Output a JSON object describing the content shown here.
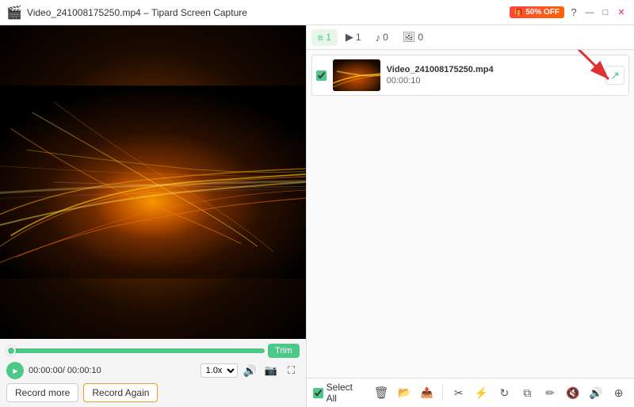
{
  "titlebar": {
    "title": "Video_241008175250.mp4  –  Tipard Screen Capture",
    "promo": "50% OFF",
    "controls": [
      "minimize",
      "maximize",
      "close"
    ]
  },
  "tabs": [
    {
      "id": "video",
      "icon": "≡",
      "count": "1",
      "label": ""
    },
    {
      "id": "play",
      "icon": "▶",
      "count": "1",
      "label": ""
    },
    {
      "id": "audio",
      "icon": "♪",
      "count": "0",
      "label": ""
    },
    {
      "id": "image",
      "icon": "🖼",
      "count": "0",
      "label": ""
    }
  ],
  "media_item": {
    "name": "Video_241008175250.mp4",
    "duration": "00:00:10"
  },
  "controls": {
    "time": "00:00:00/ 00:00:10",
    "speed": "1.0x",
    "trim_label": "Trim",
    "record_more_label": "Record more",
    "record_again_label": "Record Again",
    "select_all_label": "Select All"
  },
  "toolbar_icons": [
    "scissors",
    "equalizer",
    "refresh",
    "copy",
    "edit",
    "audio-off",
    "volume",
    "more"
  ],
  "colors": {
    "accent": "#4dc88a",
    "orange": "#e8a020",
    "red_arrow": "#e03030"
  }
}
